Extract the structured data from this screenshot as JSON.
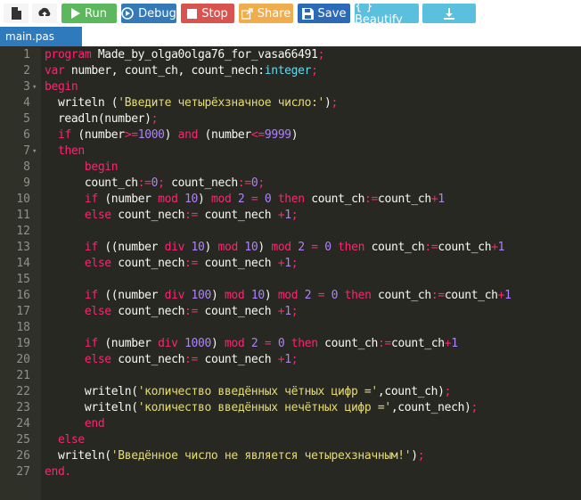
{
  "toolbar": {
    "buttons": [
      {
        "key": "new",
        "label": "",
        "icon": "new-file-icon",
        "bg": "#f5f5f5",
        "fg": "#333333"
      },
      {
        "key": "upload",
        "label": "",
        "icon": "upload-icon",
        "bg": "#f5f5f5",
        "fg": "#333333"
      },
      {
        "key": "run",
        "label": "Run",
        "icon": "play-icon",
        "bg": "#5cb85c",
        "fg": "#ffffff"
      },
      {
        "key": "debug",
        "label": "Debug",
        "icon": "debug-icon",
        "bg": "#337ab7",
        "fg": "#ffffff"
      },
      {
        "key": "stop",
        "label": "Stop",
        "icon": "stop-icon",
        "bg": "#d9534f",
        "fg": "#ffffff"
      },
      {
        "key": "share",
        "label": "Share",
        "icon": "share-icon",
        "bg": "#f0ad4e",
        "fg": "#ffffff"
      },
      {
        "key": "save",
        "label": "Save",
        "icon": "save-icon",
        "bg": "#2a6ab6",
        "fg": "#ffffff"
      },
      {
        "key": "beautify",
        "label": "{ } Beautify",
        "icon": "",
        "bg": "#5bc0de",
        "fg": "#ffffff"
      },
      {
        "key": "download",
        "label": "",
        "icon": "download-icon",
        "bg": "#5bc0de",
        "fg": "#ffffff"
      }
    ]
  },
  "tab": {
    "name": "main.pas"
  },
  "colors": {
    "editor_bg": "#272822",
    "gutter_bg": "#2f3129",
    "keyword": "#f92672",
    "string": "#e6db74",
    "number": "#ae81ff",
    "type": "#66d9ef",
    "text": "#f8f8f2"
  },
  "editor": {
    "lines": [
      {
        "n": "1",
        "fold": "",
        "tokens": [
          [
            "kw",
            "program"
          ],
          [
            "tx",
            " Made_by_olga0olga76_for_vasa66491"
          ],
          [
            "kw",
            ";"
          ]
        ]
      },
      {
        "n": "2",
        "fold": "",
        "tokens": [
          [
            "kw",
            "var"
          ],
          [
            "tx",
            " number, count_ch, count_nech:"
          ],
          [
            "ty",
            "integer"
          ],
          [
            "kw",
            ";"
          ]
        ]
      },
      {
        "n": "3",
        "fold": "▾",
        "tokens": [
          [
            "kw",
            "begin"
          ]
        ]
      },
      {
        "n": "4",
        "fold": "",
        "tokens": [
          [
            "tx",
            "  writeln ("
          ],
          [
            "st",
            "'Введите четырёхзначное число:'"
          ],
          [
            "tx",
            ")"
          ],
          [
            "kw",
            ";"
          ]
        ]
      },
      {
        "n": "5",
        "fold": "",
        "tokens": [
          [
            "tx",
            "  readln(number)"
          ],
          [
            "kw",
            ";"
          ]
        ]
      },
      {
        "n": "6",
        "fold": "",
        "tokens": [
          [
            "tx",
            "  "
          ],
          [
            "kw",
            "if"
          ],
          [
            "tx",
            " (number"
          ],
          [
            "kw",
            ">="
          ],
          [
            "nu",
            "1000"
          ],
          [
            "tx",
            ") "
          ],
          [
            "kw",
            "and"
          ],
          [
            "tx",
            " (number"
          ],
          [
            "kw",
            "<="
          ],
          [
            "nu",
            "9999"
          ],
          [
            "tx",
            ")"
          ]
        ]
      },
      {
        "n": "7",
        "fold": "▾",
        "tokens": [
          [
            "tx",
            "  "
          ],
          [
            "kw",
            "then"
          ]
        ]
      },
      {
        "n": "8",
        "fold": "",
        "tokens": [
          [
            "tx",
            "      "
          ],
          [
            "kw",
            "begin"
          ]
        ]
      },
      {
        "n": "9",
        "fold": "",
        "tokens": [
          [
            "tx",
            "      count_ch"
          ],
          [
            "kw",
            ":="
          ],
          [
            "nu",
            "0"
          ],
          [
            "kw",
            ";"
          ],
          [
            "tx",
            " count_nech"
          ],
          [
            "kw",
            ":="
          ],
          [
            "nu",
            "0"
          ],
          [
            "kw",
            ";"
          ]
        ]
      },
      {
        "n": "10",
        "fold": "",
        "tokens": [
          [
            "tx",
            "      "
          ],
          [
            "kw",
            "if"
          ],
          [
            "tx",
            " (number "
          ],
          [
            "kw",
            "mod"
          ],
          [
            "tx",
            " "
          ],
          [
            "nu",
            "10"
          ],
          [
            "tx",
            ") "
          ],
          [
            "kw",
            "mod"
          ],
          [
            "tx",
            " "
          ],
          [
            "nu",
            "2"
          ],
          [
            "tx",
            " "
          ],
          [
            "kw",
            "="
          ],
          [
            "tx",
            " "
          ],
          [
            "nu",
            "0"
          ],
          [
            "tx",
            " "
          ],
          [
            "kw",
            "then"
          ],
          [
            "tx",
            " count_ch"
          ],
          [
            "kw",
            ":="
          ],
          [
            "tx",
            "count_ch"
          ],
          [
            "kw",
            "+"
          ],
          [
            "nu",
            "1"
          ]
        ]
      },
      {
        "n": "11",
        "fold": "",
        "tokens": [
          [
            "tx",
            "      "
          ],
          [
            "kw",
            "else"
          ],
          [
            "tx",
            " count_nech"
          ],
          [
            "kw",
            ":="
          ],
          [
            "tx",
            " count_nech "
          ],
          [
            "kw",
            "+"
          ],
          [
            "nu",
            "1"
          ],
          [
            "kw",
            ";"
          ]
        ]
      },
      {
        "n": "12",
        "fold": "",
        "tokens": []
      },
      {
        "n": "13",
        "fold": "",
        "tokens": [
          [
            "tx",
            "      "
          ],
          [
            "kw",
            "if"
          ],
          [
            "tx",
            " ((number "
          ],
          [
            "kw",
            "div"
          ],
          [
            "tx",
            " "
          ],
          [
            "nu",
            "10"
          ],
          [
            "tx",
            ") "
          ],
          [
            "kw",
            "mod"
          ],
          [
            "tx",
            " "
          ],
          [
            "nu",
            "10"
          ],
          [
            "tx",
            ") "
          ],
          [
            "kw",
            "mod"
          ],
          [
            "tx",
            " "
          ],
          [
            "nu",
            "2"
          ],
          [
            "tx",
            " "
          ],
          [
            "kw",
            "="
          ],
          [
            "tx",
            " "
          ],
          [
            "nu",
            "0"
          ],
          [
            "tx",
            " "
          ],
          [
            "kw",
            "then"
          ],
          [
            "tx",
            " count_ch"
          ],
          [
            "kw",
            ":="
          ],
          [
            "tx",
            "count_ch"
          ],
          [
            "kw",
            "+"
          ],
          [
            "nu",
            "1"
          ]
        ]
      },
      {
        "n": "14",
        "fold": "",
        "tokens": [
          [
            "tx",
            "      "
          ],
          [
            "kw",
            "else"
          ],
          [
            "tx",
            " count_nech"
          ],
          [
            "kw",
            ":="
          ],
          [
            "tx",
            " count_nech "
          ],
          [
            "kw",
            "+"
          ],
          [
            "nu",
            "1"
          ],
          [
            "kw",
            ";"
          ]
        ]
      },
      {
        "n": "15",
        "fold": "",
        "tokens": []
      },
      {
        "n": "16",
        "fold": "",
        "tokens": [
          [
            "tx",
            "      "
          ],
          [
            "kw",
            "if"
          ],
          [
            "tx",
            " ((number "
          ],
          [
            "kw",
            "div"
          ],
          [
            "tx",
            " "
          ],
          [
            "nu",
            "100"
          ],
          [
            "tx",
            ") "
          ],
          [
            "kw",
            "mod"
          ],
          [
            "tx",
            " "
          ],
          [
            "nu",
            "10"
          ],
          [
            "tx",
            ") "
          ],
          [
            "kw",
            "mod"
          ],
          [
            "tx",
            " "
          ],
          [
            "nu",
            "2"
          ],
          [
            "tx",
            " "
          ],
          [
            "kw",
            "="
          ],
          [
            "tx",
            " "
          ],
          [
            "nu",
            "0"
          ],
          [
            "tx",
            " "
          ],
          [
            "kw",
            "then"
          ],
          [
            "tx",
            " count_ch"
          ],
          [
            "kw",
            ":="
          ],
          [
            "tx",
            "count_ch"
          ],
          [
            "kw",
            "+"
          ],
          [
            "nu",
            "1"
          ]
        ]
      },
      {
        "n": "17",
        "fold": "",
        "tokens": [
          [
            "tx",
            "      "
          ],
          [
            "kw",
            "else"
          ],
          [
            "tx",
            " count_nech"
          ],
          [
            "kw",
            ":="
          ],
          [
            "tx",
            " count_nech "
          ],
          [
            "kw",
            "+"
          ],
          [
            "nu",
            "1"
          ],
          [
            "kw",
            ";"
          ]
        ]
      },
      {
        "n": "18",
        "fold": "",
        "tokens": []
      },
      {
        "n": "19",
        "fold": "",
        "tokens": [
          [
            "tx",
            "      "
          ],
          [
            "kw",
            "if"
          ],
          [
            "tx",
            " (number "
          ],
          [
            "kw",
            "div"
          ],
          [
            "tx",
            " "
          ],
          [
            "nu",
            "1000"
          ],
          [
            "tx",
            ") "
          ],
          [
            "kw",
            "mod"
          ],
          [
            "tx",
            " "
          ],
          [
            "nu",
            "2"
          ],
          [
            "tx",
            " "
          ],
          [
            "kw",
            "="
          ],
          [
            "tx",
            " "
          ],
          [
            "nu",
            "0"
          ],
          [
            "tx",
            " "
          ],
          [
            "kw",
            "then"
          ],
          [
            "tx",
            " count_ch"
          ],
          [
            "kw",
            ":="
          ],
          [
            "tx",
            "count_ch"
          ],
          [
            "kw",
            "+"
          ],
          [
            "nu",
            "1"
          ]
        ]
      },
      {
        "n": "20",
        "fold": "",
        "tokens": [
          [
            "tx",
            "      "
          ],
          [
            "kw",
            "else"
          ],
          [
            "tx",
            " count_nech"
          ],
          [
            "kw",
            ":="
          ],
          [
            "tx",
            " count_nech "
          ],
          [
            "kw",
            "+"
          ],
          [
            "nu",
            "1"
          ],
          [
            "kw",
            ";"
          ]
        ]
      },
      {
        "n": "21",
        "fold": "",
        "tokens": []
      },
      {
        "n": "22",
        "fold": "",
        "tokens": [
          [
            "tx",
            "      writeln("
          ],
          [
            "st",
            "'количество введённых чётных цифр ='"
          ],
          [
            "tx",
            ",count_ch)"
          ],
          [
            "kw",
            ";"
          ]
        ]
      },
      {
        "n": "23",
        "fold": "",
        "tokens": [
          [
            "tx",
            "      writeln("
          ],
          [
            "st",
            "'количество введённых нечётных цифр ='"
          ],
          [
            "tx",
            ",count_nech)"
          ],
          [
            "kw",
            ";"
          ]
        ]
      },
      {
        "n": "24",
        "fold": "",
        "tokens": [
          [
            "tx",
            "      "
          ],
          [
            "kw",
            "end"
          ]
        ]
      },
      {
        "n": "25",
        "fold": "",
        "tokens": [
          [
            "tx",
            "  "
          ],
          [
            "kw",
            "else"
          ]
        ]
      },
      {
        "n": "26",
        "fold": "",
        "tokens": [
          [
            "tx",
            "  writeln("
          ],
          [
            "st",
            "'Введённое число не является четырехзначным!'"
          ],
          [
            "tx",
            ")"
          ],
          [
            "kw",
            ";"
          ]
        ]
      },
      {
        "n": "27",
        "fold": "",
        "tokens": [
          [
            "kw",
            "end."
          ]
        ]
      }
    ]
  }
}
